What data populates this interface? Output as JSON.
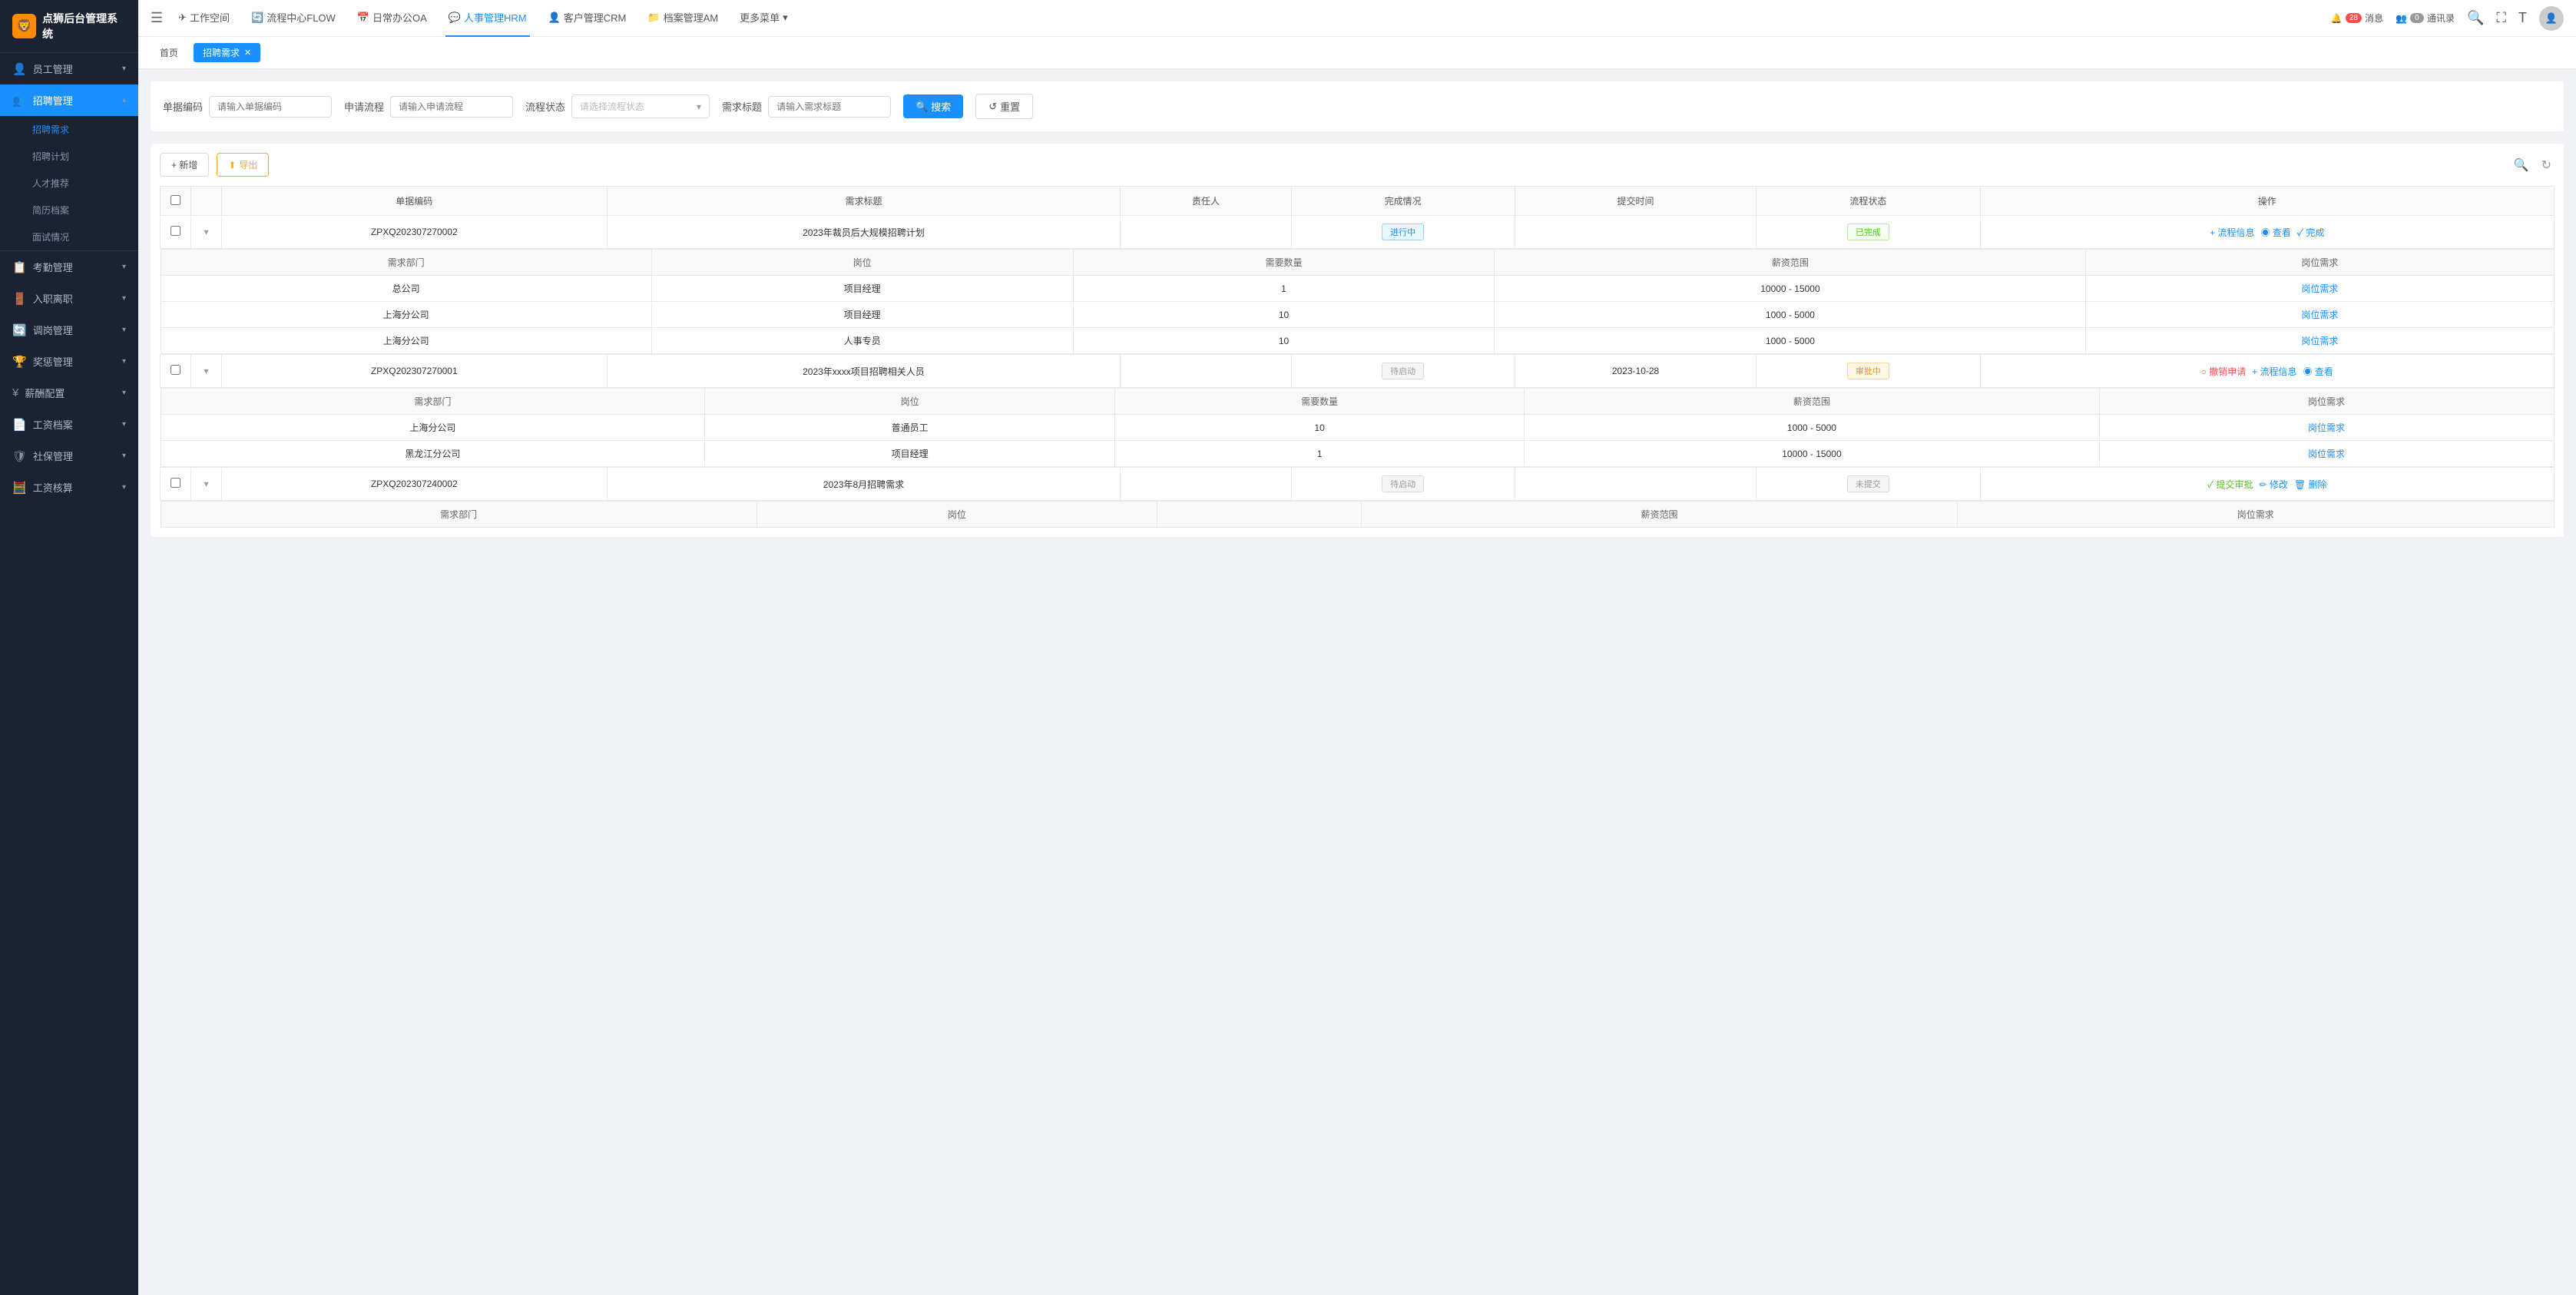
{
  "sidebar": {
    "logo": {
      "icon": "🦁",
      "text": "点狮后台管理系统"
    },
    "items": [
      {
        "id": "employee",
        "icon": "👤",
        "label": "员工管理",
        "hasChevron": true,
        "active": false
      },
      {
        "id": "recruit",
        "icon": "👥",
        "label": "招聘管理",
        "hasChevron": true,
        "active": true,
        "expanded": true
      },
      {
        "id": "recruit-demand",
        "label": "招聘需求",
        "isChild": true,
        "active": true
      },
      {
        "id": "recruit-plan",
        "label": "招聘计划",
        "isChild": true
      },
      {
        "id": "talent-push",
        "label": "人才推荐",
        "isChild": true
      },
      {
        "id": "resume",
        "label": "简历档案",
        "isChild": true
      },
      {
        "id": "interview",
        "label": "面试情况",
        "isChild": true
      },
      {
        "id": "attendance",
        "icon": "📋",
        "label": "考勤管理",
        "hasChevron": true
      },
      {
        "id": "onboarding",
        "icon": "🚪",
        "label": "入职离职",
        "hasChevron": true
      },
      {
        "id": "transfer",
        "icon": "🔄",
        "label": "调岗管理",
        "hasChevron": true
      },
      {
        "id": "rewards",
        "icon": "🏆",
        "label": "奖惩管理",
        "hasChevron": true
      },
      {
        "id": "salary-config",
        "icon": "💰",
        "label": "薪酬配置",
        "hasChevron": true
      },
      {
        "id": "salary-file",
        "icon": "📄",
        "label": "工资档案",
        "hasChevron": true
      },
      {
        "id": "social-security",
        "icon": "🛡",
        "label": "社保管理",
        "hasChevron": true
      },
      {
        "id": "payroll",
        "icon": "🧮",
        "label": "工资核算",
        "hasChevron": true
      }
    ]
  },
  "topnav": {
    "hamburger": "☰",
    "items": [
      {
        "id": "workspace",
        "icon": "✈",
        "label": "工作空间"
      },
      {
        "id": "flow",
        "icon": "🔄",
        "label": "流程中心FLOW"
      },
      {
        "id": "oa",
        "icon": "📅",
        "label": "日常办公OA"
      },
      {
        "id": "hrm",
        "icon": "💬",
        "label": "人事管理HRM",
        "active": true
      },
      {
        "id": "crm",
        "icon": "👤",
        "label": "客户管理CRM"
      },
      {
        "id": "am",
        "icon": "📁",
        "label": "档案管理AM"
      },
      {
        "id": "more",
        "label": "更多菜单",
        "hasChevron": true
      }
    ],
    "notifications": {
      "label": "消息",
      "count": "28"
    },
    "communications": {
      "label": "通讯录",
      "count": "0"
    }
  },
  "breadcrumb": {
    "home": "首页",
    "current": "招聘需求"
  },
  "search": {
    "fields": [
      {
        "id": "form-code",
        "label": "单据编码",
        "placeholder": "请输入单据编码"
      },
      {
        "id": "apply-flow",
        "label": "申请流程",
        "placeholder": "请输入申请流程"
      },
      {
        "id": "flow-status",
        "label": "流程状态",
        "placeholder": "请选择流程状态",
        "isSelect": true
      },
      {
        "id": "demand-title",
        "label": "需求标题",
        "placeholder": "请输入需求标题"
      }
    ],
    "searchBtn": "搜索",
    "resetBtn": "重置"
  },
  "toolbar": {
    "addBtn": "+ 新增",
    "exportBtn": "导出"
  },
  "table": {
    "columns": [
      "单据编码",
      "需求标题",
      "责任人",
      "完成情况",
      "提交时间",
      "流程状态",
      "操作"
    ],
    "subColumns": [
      "需求部门",
      "岗位",
      "需要数量",
      "薪资范围",
      "岗位需求"
    ],
    "rows": [
      {
        "id": "ZPXQ202307270002",
        "title": "2023年裁员后大规模招聘计划",
        "responsible": "",
        "completion": "进行中",
        "completionStyle": "progress",
        "submitTime": "",
        "flowStatus": "已完成",
        "flowStatusStyle": "done",
        "actions": [
          {
            "label": "+ 流程信息",
            "color": "blue"
          },
          {
            "label": "◉ 查看",
            "color": "blue"
          },
          {
            "label": "✓ 完成",
            "color": "blue"
          }
        ],
        "subRows": [
          {
            "dept": "总公司",
            "position": "项目经理",
            "count": "1",
            "salaryRange": "10000 - 15000",
            "posReq": "岗位需求"
          },
          {
            "dept": "上海分公司",
            "position": "项目经理",
            "count": "10",
            "salaryRange": "1000 - 5000",
            "posReq": "岗位需求"
          },
          {
            "dept": "上海分公司",
            "position": "人事专员",
            "count": "10",
            "salaryRange": "1000 - 5000",
            "posReq": "岗位需求"
          }
        ]
      },
      {
        "id": "ZPXQ202307270001",
        "title": "2023年xxxx项目招聘相关人员",
        "responsible": "",
        "completion": "待启动",
        "completionStyle": "pending",
        "submitTime": "2023-10-28",
        "flowStatus": "审批中",
        "flowStatusStyle": "reviewing",
        "actions": [
          {
            "label": "○ 撤销申请",
            "color": "red"
          },
          {
            "label": "+ 流程信息",
            "color": "blue"
          },
          {
            "label": "◉ 查看",
            "color": "blue"
          }
        ],
        "subRows": [
          {
            "dept": "上海分公司",
            "position": "普通员工",
            "count": "10",
            "salaryRange": "1000 - 5000",
            "posReq": "岗位需求"
          },
          {
            "dept": "黑龙江分公司",
            "position": "项目经理",
            "count": "1",
            "salaryRange": "10000 - 15000",
            "posReq": "岗位需求"
          }
        ]
      },
      {
        "id": "ZPXQ202307240002",
        "title": "2023年8月招聘需求",
        "responsible": "",
        "completion": "待启动",
        "completionStyle": "pending",
        "submitTime": "",
        "flowStatus": "未提交",
        "flowStatusStyle": "not-submitted",
        "actions": [
          {
            "label": "✓ 提交审批",
            "color": "green"
          },
          {
            "label": "✏ 修改",
            "color": "blue"
          },
          {
            "label": "🗑 删除",
            "color": "blue"
          }
        ],
        "subRows": []
      }
    ],
    "subRowsLastLabel": "需求部门",
    "subRowsLastCol2": "岗位",
    "subRowsLastCol3": "薪资范围",
    "subRowsLastCol4": "岗位需求"
  }
}
